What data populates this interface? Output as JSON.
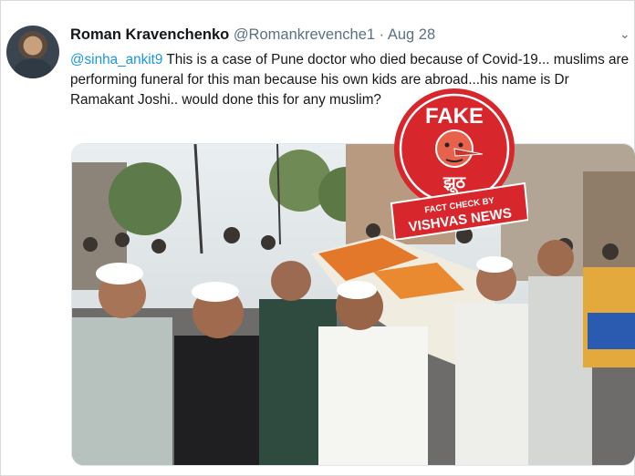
{
  "tweet": {
    "display_name": "Roman Kravenchenko",
    "handle": "@Romankrevenche1",
    "separator": "·",
    "date": "Aug 28",
    "mention": "@sinha_ankit9",
    "text": " This is a case of Pune doctor who died because of Covid-19... muslims are performing funeral for this man because his own kids are abroad...his name is Dr Ramakant Joshi.. would done this for any muslim?",
    "more_icon": "chevron-down-icon"
  },
  "stamp": {
    "label": "FAKE",
    "hindi": "झूठ",
    "tagline": "FACT CHECK BY",
    "brand": "VISHVAS NEWS",
    "colors": {
      "red": "#d7262c",
      "white": "#ffffff",
      "face": "#e8614a"
    }
  },
  "colors": {
    "link": "#1b95e0",
    "secondary": "#5b7083",
    "text": "#14171a"
  }
}
